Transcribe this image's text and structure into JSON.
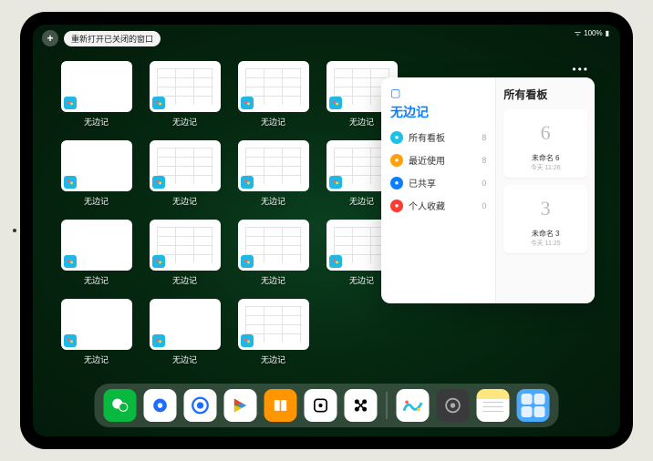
{
  "status": {
    "battery": "100%",
    "wifi": "•"
  },
  "topbar": {
    "plus": "+",
    "reopen_label": "重新打开已关闭的窗口"
  },
  "thumb_label": "无边记",
  "thumbs": [
    {
      "variant": "blank"
    },
    {
      "variant": "grid"
    },
    {
      "variant": "grid"
    },
    {
      "variant": "grid"
    },
    {
      "variant": "blank"
    },
    {
      "variant": "grid"
    },
    {
      "variant": "grid"
    },
    {
      "variant": "grid"
    },
    {
      "variant": "blank"
    },
    {
      "variant": "grid"
    },
    {
      "variant": "grid"
    },
    {
      "variant": "grid"
    },
    {
      "variant": "blank"
    },
    {
      "variant": "blank"
    },
    {
      "variant": "grid"
    }
  ],
  "popover": {
    "title": "无边记",
    "right_title": "所有看板",
    "sidebar": [
      {
        "label": "所有看板",
        "count": 8,
        "color": "#1fc0e8"
      },
      {
        "label": "最近使用",
        "count": 8,
        "color": "#ff9f0a"
      },
      {
        "label": "已共享",
        "count": 0,
        "color": "#0a7eff"
      },
      {
        "label": "个人收藏",
        "count": 0,
        "color": "#ff3b30"
      }
    ],
    "boards": [
      {
        "glyph": "6",
        "name": "未命名 6",
        "time": "今天 11:26"
      },
      {
        "glyph": "3",
        "name": "未命名 3",
        "time": "今天 11:25"
      }
    ]
  },
  "dock": [
    {
      "id": "wechat",
      "name": "微信",
      "cls": "di-wechat"
    },
    {
      "id": "qqhd",
      "name": "QQ HD",
      "cls": "di-qqhd"
    },
    {
      "id": "browser",
      "name": "QQ浏览器",
      "cls": "di-qq"
    },
    {
      "id": "play",
      "name": "Google Play",
      "cls": "di-play"
    },
    {
      "id": "books",
      "name": "图书",
      "cls": "di-books"
    },
    {
      "id": "dice",
      "name": "游戏",
      "cls": "di-dice"
    },
    {
      "id": "connect",
      "name": "连接",
      "cls": "di-connect"
    },
    {
      "id": "freeform",
      "name": "无边记",
      "cls": "di-freeform"
    },
    {
      "id": "settings",
      "name": "设置",
      "cls": "di-settings"
    },
    {
      "id": "notes",
      "name": "备忘录",
      "cls": "di-notes"
    },
    {
      "id": "folder",
      "name": "文件夹",
      "cls": "di-folder"
    }
  ]
}
